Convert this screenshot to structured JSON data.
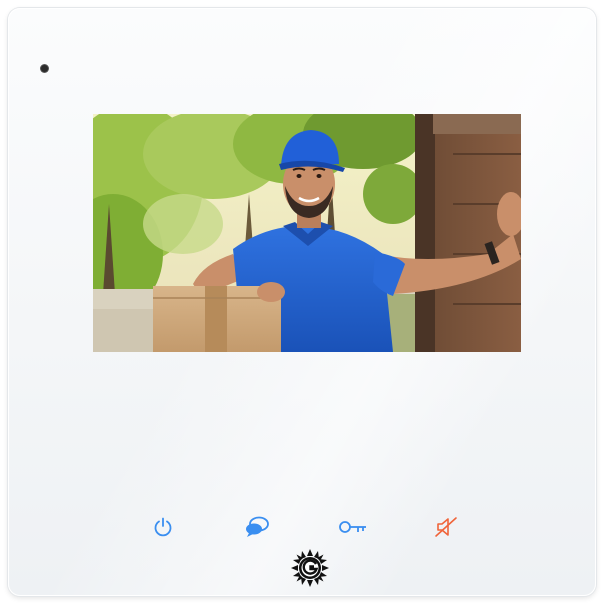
{
  "device": {
    "type": "video-intercom-monitor"
  },
  "screen": {
    "feed": "doorbell-camera-view",
    "subject": "delivery-person-with-package"
  },
  "buttons": [
    {
      "id": "power",
      "icon": "power-icon",
      "color": "#3a8ef0"
    },
    {
      "id": "talk",
      "icon": "speech-bubbles-icon",
      "color": "#3a8ef0"
    },
    {
      "id": "unlock",
      "icon": "key-icon",
      "color": "#3a8ef0"
    },
    {
      "id": "mute",
      "icon": "speaker-mute-icon",
      "color": "#f0643a"
    }
  ],
  "logo": {
    "icon": "brand-sun-g-logo"
  },
  "colors": {
    "accent": "#3a8ef0",
    "mute": "#f0643a",
    "shirt": "#1d5fd0",
    "cap": "#1f5ad6"
  }
}
